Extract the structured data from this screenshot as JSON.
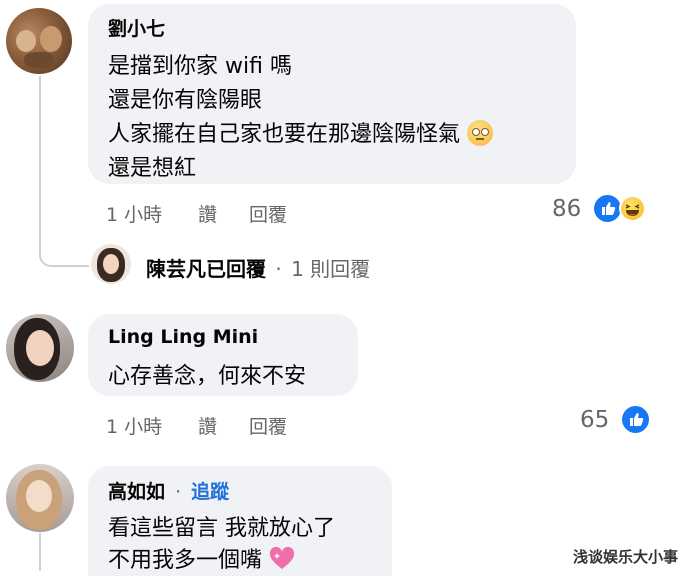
{
  "comments": [
    {
      "author": "劉小七",
      "lines": [
        "是擋到你家 wifi 嗎",
        "還是你有陰陽眼",
        "人家擺在自己家也要在那邊陰陽怪氣",
        "還是想紅"
      ],
      "time": "1 小時",
      "like": "讚",
      "reply": "回覆",
      "reaction_count": "86",
      "reactions": [
        "like-icon",
        "haha-icon"
      ]
    },
    {
      "author": "Ling Ling Mini",
      "lines": [
        "心存善念，何來不安"
      ],
      "time": "1 小時",
      "like": "讚",
      "reply": "回覆",
      "reaction_count": "65",
      "reactions": [
        "like-icon"
      ]
    },
    {
      "author": "高如如",
      "separator": "·",
      "follow": "追蹤",
      "lines": [
        "看這些留言 我就放心了",
        "不用我多一個嘴"
      ]
    }
  ],
  "reply_summary": {
    "name": "陳芸凡已回覆",
    "separator": "·",
    "count_text": "1 則回覆"
  },
  "watermark": "浅谈娱乐大小事",
  "colors": {
    "bubble": "#f0f2f5",
    "meta": "#65676b",
    "link": "#216fdb",
    "like_blue": "#1877f2",
    "haha_yellow": "#f7b928"
  }
}
